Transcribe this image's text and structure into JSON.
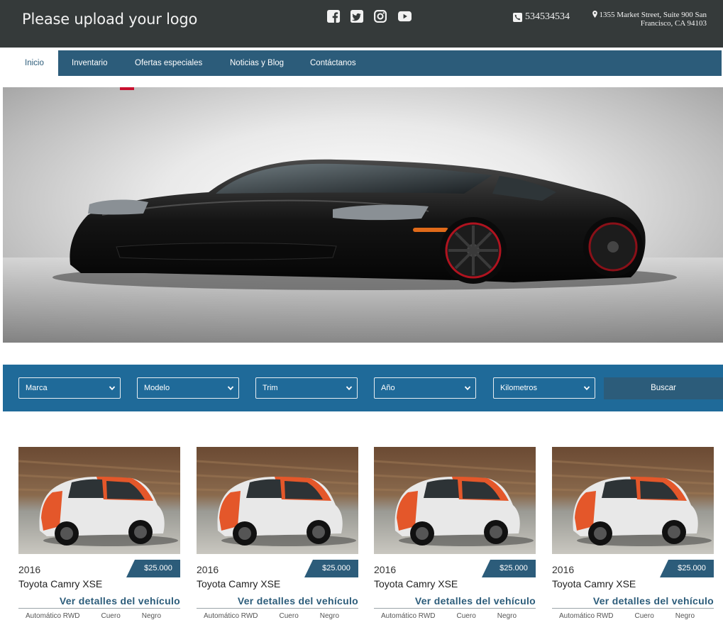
{
  "header": {
    "logo_text": "Please upload your logo",
    "social_icons": [
      "facebook-icon",
      "twitter-icon",
      "instagram-icon",
      "youtube-icon"
    ],
    "phone": "534534534",
    "address_line1": "1355 Market Street, Suite 900 San",
    "address_line2": "Francisco, CA 94103",
    "bg_color": "#353a3a"
  },
  "nav": {
    "items": [
      {
        "label": "Inicio"
      },
      {
        "label": "Inventario"
      },
      {
        "label": "Ofertas especiales"
      },
      {
        "label": "Noticias y Blog"
      },
      {
        "label": "Contáctanos"
      }
    ],
    "bg_color": "#2c5c7a"
  },
  "search": {
    "selects": [
      {
        "label": "Marca"
      },
      {
        "label": "Modelo"
      },
      {
        "label": "Trim"
      },
      {
        "label": "Año"
      },
      {
        "label": "Kilometros"
      }
    ],
    "button_label": "Buscar",
    "bg_color": "#1f6a99"
  },
  "listings": [
    {
      "year": "2016",
      "price": "$25.000",
      "name": "Toyota Camry XSE",
      "link": "Ver detalles del vehículo",
      "spec1": "Automático RWD",
      "spec2": "Cuero",
      "spec3": "Negro"
    },
    {
      "year": "2016",
      "price": "$25.000",
      "name": "Toyota Camry XSE",
      "link": "Ver detalles del vehículo",
      "spec1": "Automático RWD",
      "spec2": "Cuero",
      "spec3": "Negro"
    },
    {
      "year": "2016",
      "price": "$25.000",
      "name": "Toyota Camry XSE",
      "link": "Ver detalles del vehículo",
      "spec1": "Automático RWD",
      "spec2": "Cuero",
      "spec3": "Negro"
    },
    {
      "year": "2016",
      "price": "$25.000",
      "name": "Toyota Camry XSE",
      "link": "Ver detalles del vehículo",
      "spec1": "Automático RWD",
      "spec2": "Cuero",
      "spec3": "Negro"
    }
  ]
}
